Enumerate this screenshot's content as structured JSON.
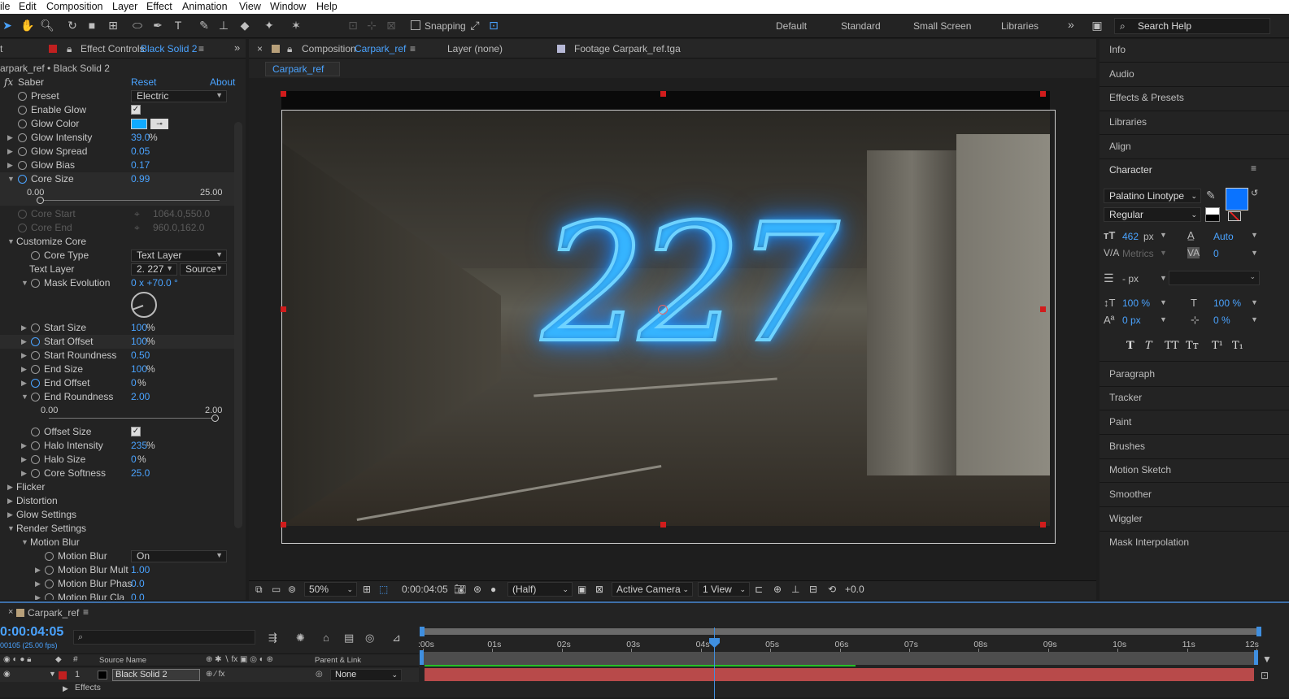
{
  "menubar": {
    "items": [
      "ile",
      "Edit",
      "Composition",
      "Layer",
      "Effect",
      "Animation",
      "View",
      "Window",
      "Help"
    ]
  },
  "toolbar": {
    "snapping_label": "Snapping",
    "workspaces": [
      "Default",
      "Standard",
      "Small Screen",
      "Libraries"
    ],
    "more": "»",
    "search_placeholder": "Search Help"
  },
  "effect_controls": {
    "tab_close": "t",
    "tab_label": "Effect Controls",
    "tab_layer": "Black Solid 2",
    "layer_path": "arpark_ref • Black Solid 2",
    "effect_name": "Saber",
    "reset": "Reset",
    "about": "About",
    "props": {
      "preset": {
        "name": "Preset",
        "value": "Electric"
      },
      "enable_glow": {
        "name": "Enable Glow"
      },
      "glow_color": {
        "name": "Glow Color",
        "color": "#10aaff"
      },
      "glow_intensity": {
        "name": "Glow Intensity",
        "value": "39.0",
        "unit": "%"
      },
      "glow_spread": {
        "name": "Glow Spread",
        "value": "0.05"
      },
      "glow_bias": {
        "name": "Glow Bias",
        "value": "0.17"
      },
      "core_size": {
        "name": "Core Size",
        "value": "0.99",
        "min": "0.00",
        "max": "25.00"
      },
      "core_start": {
        "name": "Core Start",
        "value": "1064.0,550.0"
      },
      "core_end": {
        "name": "Core End",
        "value": "960.0,162.0"
      },
      "customize_core": {
        "name": "Customize Core"
      },
      "core_type": {
        "name": "Core Type",
        "value": "Text Layer"
      },
      "text_layer": {
        "name": "Text Layer",
        "value": "2. 227",
        "source": "Source"
      },
      "mask_evolution": {
        "name": "Mask Evolution",
        "value": "0 x +70.0 °"
      },
      "start_size": {
        "name": "Start Size",
        "value": "100",
        "unit": "%"
      },
      "start_offset": {
        "name": "Start Offset",
        "value": "100",
        "unit": "%"
      },
      "start_roundness": {
        "name": "Start Roundness",
        "value": "0.50"
      },
      "end_size": {
        "name": "End Size",
        "value": "100",
        "unit": "%"
      },
      "end_offset": {
        "name": "End Offset",
        "value": "0",
        "unit": "%"
      },
      "end_roundness": {
        "name": "End Roundness",
        "value": "2.00",
        "min": "0.00",
        "max": "2.00"
      },
      "offset_size": {
        "name": "Offset Size"
      },
      "halo_intensity": {
        "name": "Halo Intensity",
        "value": "235",
        "unit": "%"
      },
      "halo_size": {
        "name": "Halo Size",
        "value": "0",
        "unit": "%"
      },
      "core_softness": {
        "name": "Core Softness",
        "value": "25.0"
      },
      "flicker": {
        "name": "Flicker"
      },
      "distortion": {
        "name": "Distortion"
      },
      "glow_settings": {
        "name": "Glow Settings"
      },
      "render_settings": {
        "name": "Render Settings"
      },
      "motion_blur_group": {
        "name": "Motion Blur"
      },
      "motion_blur": {
        "name": "Motion Blur",
        "value": "On"
      },
      "motion_blur_mult": {
        "name": "Motion Blur Mult",
        "value": "1.00"
      },
      "motion_blur_phase": {
        "name": "Motion Blur Phas",
        "value": "0.0"
      },
      "motion_blur_clamp": {
        "name": "Motion Blur Cla",
        "value": "0.0"
      }
    }
  },
  "composition": {
    "tab_label": "Composition",
    "tab_comp": "Carpark_ref",
    "layer_tab": "Layer  (none)",
    "footage_tab": "Footage  Carpark_ref.tga",
    "breadcrumb": "Carpark_ref",
    "overlay_text": "227",
    "viewer": {
      "zoom": "50%",
      "timecode": "0:00:04:05",
      "resolution": "(Half)",
      "camera": "Active Camera",
      "views": "1 View",
      "exposure": "+0.0"
    }
  },
  "right_panel": {
    "items_top": [
      "Info",
      "Audio",
      "Effects & Presets",
      "Libraries",
      "Align"
    ],
    "character": {
      "title": "Character",
      "font": "Palatino Linotype",
      "style": "Regular",
      "size": "462",
      "size_unit": "px",
      "leading": "Auto",
      "kerning": "Metrics",
      "tracking": "0",
      "stroke": "- px",
      "vscale": "100 %",
      "hscale": "100 %",
      "baseline": "0 px",
      "tsume": "0 %",
      "styles": [
        "T",
        "T",
        "TT",
        "Tт",
        "T¹",
        "T₁"
      ],
      "fill_color": "#0a73ff"
    },
    "items_bottom": [
      "Paragraph",
      "Tracker",
      "Paint",
      "Brushes",
      "Motion Sketch",
      "Smoother",
      "Wiggler",
      "Mask Interpolation"
    ]
  },
  "timeline": {
    "comp_name": "Carpark_ref",
    "timecode": "0:00:04:05",
    "fps": "00105 (25.00 fps)",
    "col_source": "Source Name",
    "col_parent": "Parent & Link",
    "layer_index": "1",
    "layer_name": "Black Solid 2",
    "parent_value": "None",
    "effects_label": "Effects",
    "ruler": [
      ":00s",
      "01s",
      "02s",
      "03s",
      "04s",
      "05s",
      "06s",
      "07s",
      "08s",
      "09s",
      "10s",
      "11s",
      "12s"
    ]
  }
}
